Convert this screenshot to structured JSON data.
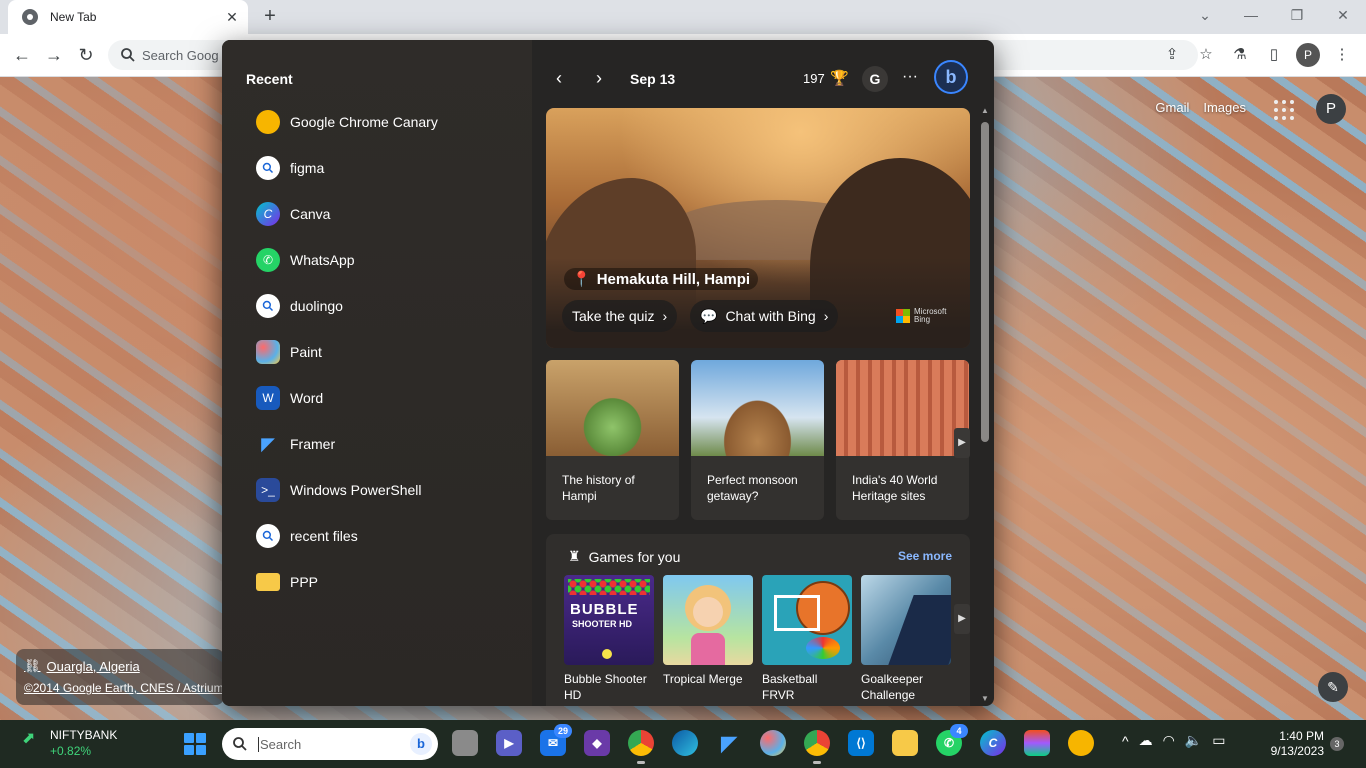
{
  "browser": {
    "tab_title": "New Tab",
    "close_symbol": "✕",
    "newtab_symbol": "+",
    "window_buttons": [
      "⌄",
      "—",
      "❐",
      "✕"
    ],
    "omnibox_placeholder": "Search Goog",
    "avatar_letter": "P",
    "nav_back": "←",
    "nav_forward": "→",
    "nav_reload": "↻"
  },
  "ntp": {
    "links": [
      "Gmail",
      "Images"
    ],
    "avatar_letter": "P",
    "location": "Ouargla, Algeria",
    "credit": "©2014 Google Earth, CNES / Astrium",
    "edit_symbol": "✎"
  },
  "flyout": {
    "recent_title": "Recent",
    "recent": [
      {
        "label": "Google Chrome Canary",
        "icon": "chrome-canary-icon",
        "color": "#f7b500"
      },
      {
        "label": "figma",
        "icon": "search-icon",
        "color": "#ffffff"
      },
      {
        "label": "Canva",
        "icon": "canva-icon",
        "color": "#7d2ae8"
      },
      {
        "label": "WhatsApp",
        "icon": "whatsapp-icon",
        "color": "#25d366"
      },
      {
        "label": "duolingo",
        "icon": "search-icon",
        "color": "#ffffff"
      },
      {
        "label": "Paint",
        "icon": "paint-icon",
        "color": "#5ab0e8"
      },
      {
        "label": "Word",
        "icon": "word-icon",
        "color": "#185abd"
      },
      {
        "label": "Framer",
        "icon": "framer-icon",
        "color": "#0a84ff"
      },
      {
        "label": "Windows PowerShell",
        "icon": "powershell-icon",
        "color": "#2a4a9a"
      },
      {
        "label": "recent files",
        "icon": "search-icon",
        "color": "#ffffff"
      },
      {
        "label": "PPP",
        "icon": "folder-icon",
        "color": "#f7c948"
      }
    ],
    "header": {
      "prev": "‹",
      "next": "›",
      "date": "Sep 13",
      "points": "197",
      "trophy": "🏆",
      "g_label": "G",
      "more": "···",
      "bing_letter": "b"
    },
    "hero": {
      "place": "Hemakuta Hill, Hampi",
      "quiz_label": "Take the quiz",
      "chat_label": "Chat with Bing",
      "chevron": "›",
      "brand_line1": "Microsoft",
      "brand_line2": "Bing"
    },
    "cards": [
      {
        "title": "The history of Hampi"
      },
      {
        "title": "Perfect monsoon getaway?"
      },
      {
        "title": "India's 40 World Heritage sites"
      }
    ],
    "cards_next": "▶",
    "games": {
      "title": "Games for you",
      "see_more": "See more",
      "next": "▶",
      "items": [
        {
          "title": "Bubble Shooter HD",
          "art_line1": "BUBBLE",
          "art_line2": "SHOOTER HD"
        },
        {
          "title": "Tropical Merge"
        },
        {
          "title": "Basketball FRVR"
        },
        {
          "title": "Goalkeeper Challenge"
        }
      ]
    },
    "scroll_up": "▲",
    "scroll_down": "▼"
  },
  "taskbar": {
    "ticker_name": "NIFTYBANK",
    "ticker_change": "+0.82%",
    "search_placeholder": "Search",
    "bing_letter": "b",
    "mail_badge": "29",
    "whatsapp_badge": "4",
    "time": "1:40 PM",
    "date": "9/13/2023",
    "notifications": "3",
    "tray_chevron": "^"
  },
  "colors": {
    "accent_blue": "#3a86ff",
    "flyout_bg": "#262524",
    "see_more": "#8ab8ff",
    "ticker_green": "#3fd37a"
  }
}
